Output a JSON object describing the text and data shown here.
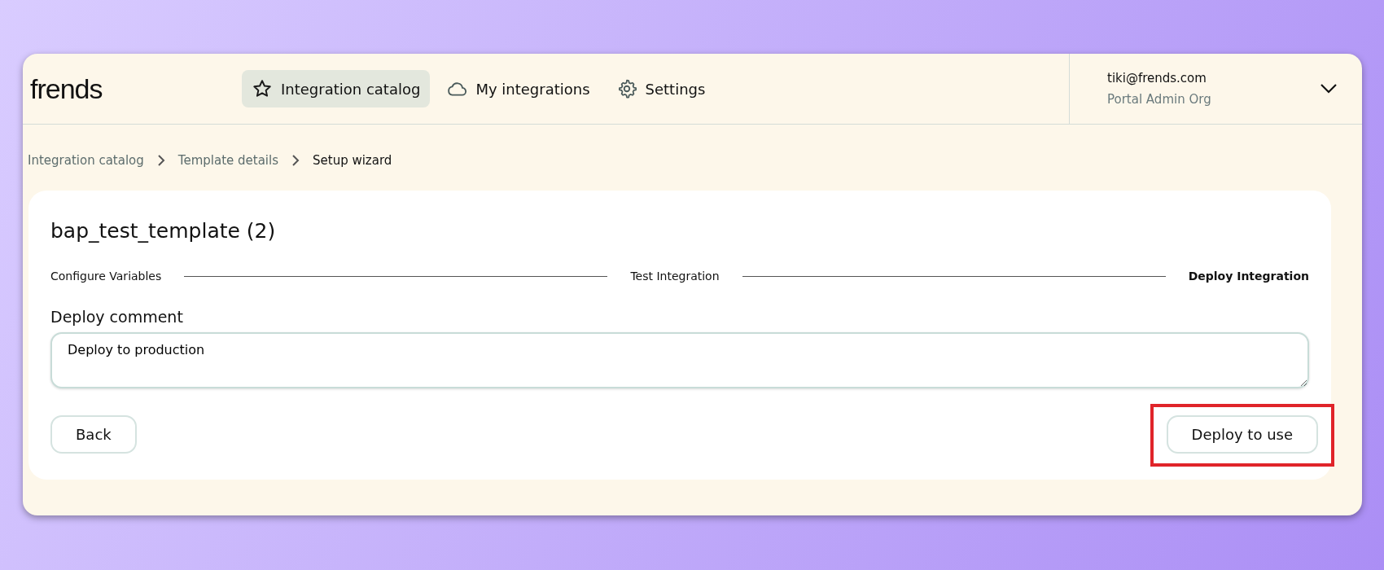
{
  "logo": "frends",
  "nav": [
    {
      "label": "Integration catalog",
      "selected": true
    },
    {
      "label": "My integrations",
      "selected": false
    },
    {
      "label": "Settings",
      "selected": false
    }
  ],
  "account": {
    "email": "tiki@frends.com",
    "org": "Portal Admin Org"
  },
  "breadcrumbs": [
    {
      "label": "Integration catalog",
      "current": false
    },
    {
      "label": "Template details",
      "current": false
    },
    {
      "label": "Setup wizard",
      "current": true
    }
  ],
  "title": "bap_test_template (2)",
  "steps": [
    {
      "label": "Configure Variables",
      "selected": false
    },
    {
      "label": "Test Integration",
      "selected": false
    },
    {
      "label": "Deploy Integration",
      "selected": true
    }
  ],
  "comment": {
    "label": "Deploy comment",
    "value": "Deploy to production"
  },
  "buttons": [
    {
      "label": "Back",
      "highlighted": false
    },
    {
      "label": "Deploy to use",
      "highlighted": true
    }
  ]
}
